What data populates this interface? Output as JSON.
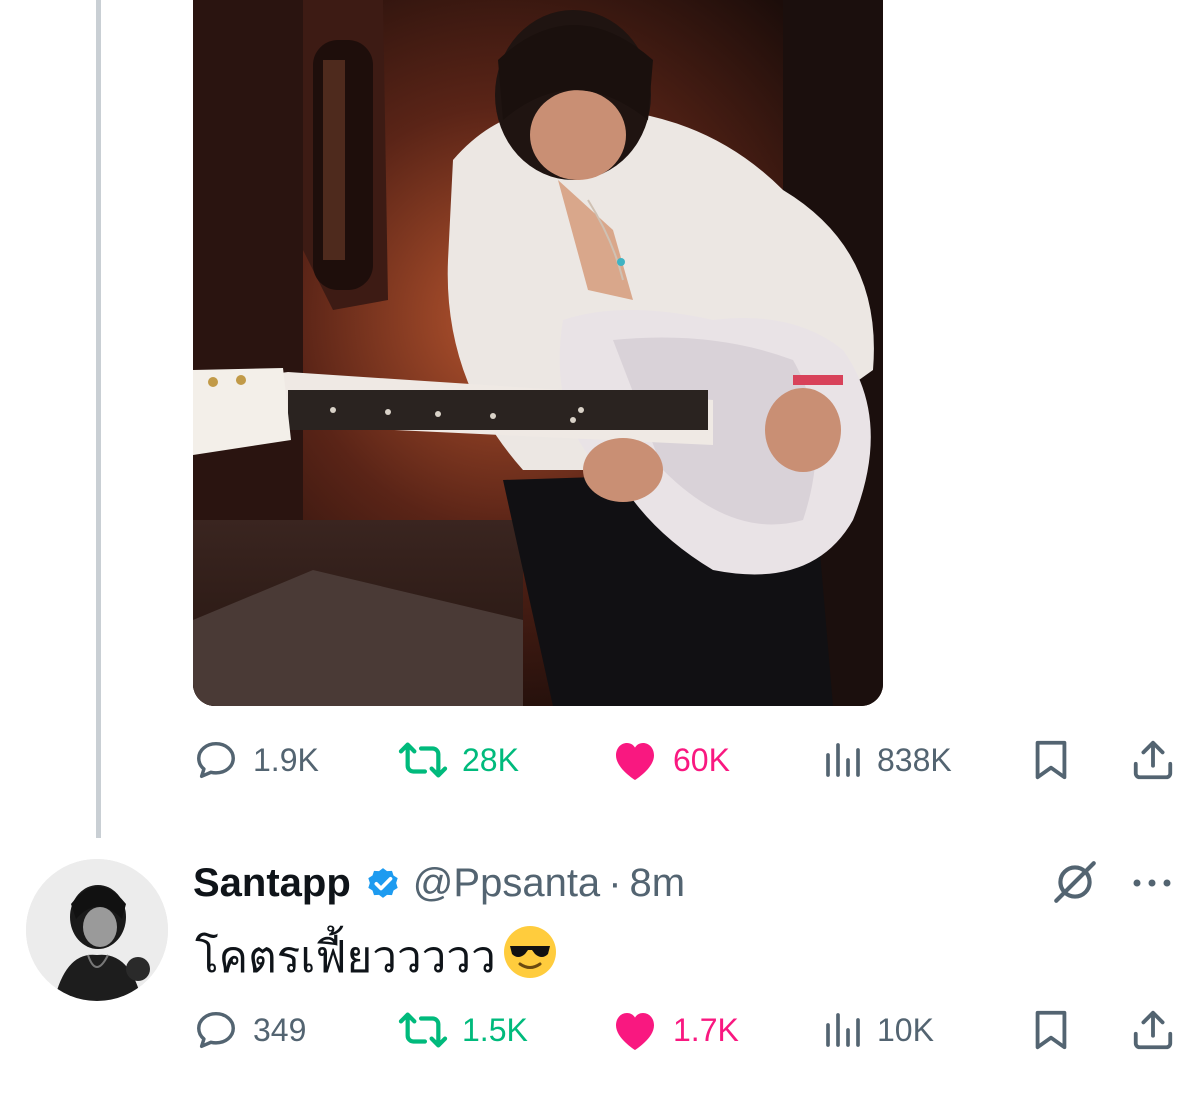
{
  "post": {
    "stats": {
      "replies": "1.9K",
      "reposts": "28K",
      "likes": "60K",
      "views": "838K"
    }
  },
  "reply": {
    "display_name": "Santapp",
    "handle": "@Ppsanta",
    "separator": "·",
    "time": "8m",
    "text": "โคตรเฟี้ยววววว",
    "stats": {
      "replies": "349",
      "reposts": "1.5K",
      "likes": "1.7K",
      "views": "10K"
    }
  },
  "colors": {
    "repost": "#00ba7c",
    "like": "#f91880",
    "muted": "#536471",
    "verified": "#1d9bf0"
  },
  "icons": [
    "reply-icon",
    "repost-icon",
    "heart-icon",
    "views-icon",
    "bookmark-icon",
    "share-icon",
    "mute-icon",
    "verified-badge-icon",
    "grok-icon",
    "more-icon",
    "sunglasses-emoji-icon"
  ]
}
